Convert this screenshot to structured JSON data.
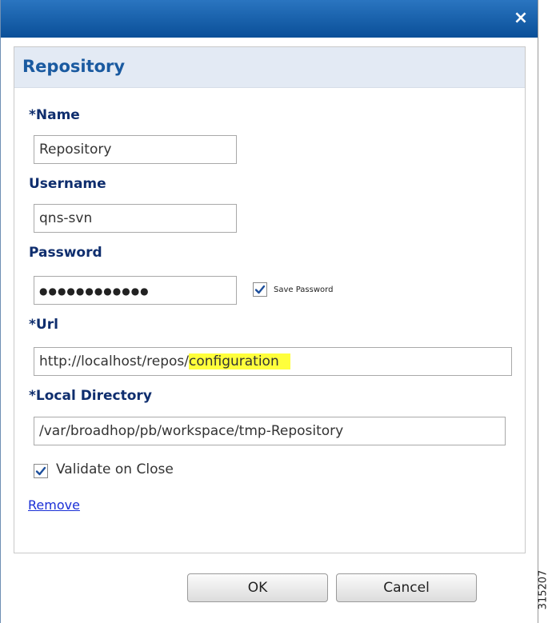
{
  "dialog": {
    "close_symbol": "×",
    "panel_title": "Repository"
  },
  "form": {
    "name_label": "*Name",
    "name_value": "Repository",
    "username_label": "Username",
    "username_value": "qns-svn",
    "password_label": "Password",
    "password_dots": "●●●●●●●●●●●●",
    "save_password_label": "Save Password",
    "save_password_checked": true,
    "url_label": "*Url",
    "url_prefix": "http://localhost/repos/",
    "url_highlight": "configuration",
    "local_dir_label": "*Local Directory",
    "local_dir_value": "/var/broadhop/pb/workspace/tmp-Repository",
    "validate_label": "Validate on Close",
    "validate_checked": true,
    "remove_link": "Remove"
  },
  "buttons": {
    "ok": "OK",
    "cancel": "Cancel"
  },
  "watermark": "315207",
  "colors": {
    "titlebar": "#0d5aa6",
    "panel_header": "#e3eaf4",
    "label": "#0f2e6e",
    "highlight": "#ffff3c",
    "link": "#1a2fd6"
  }
}
